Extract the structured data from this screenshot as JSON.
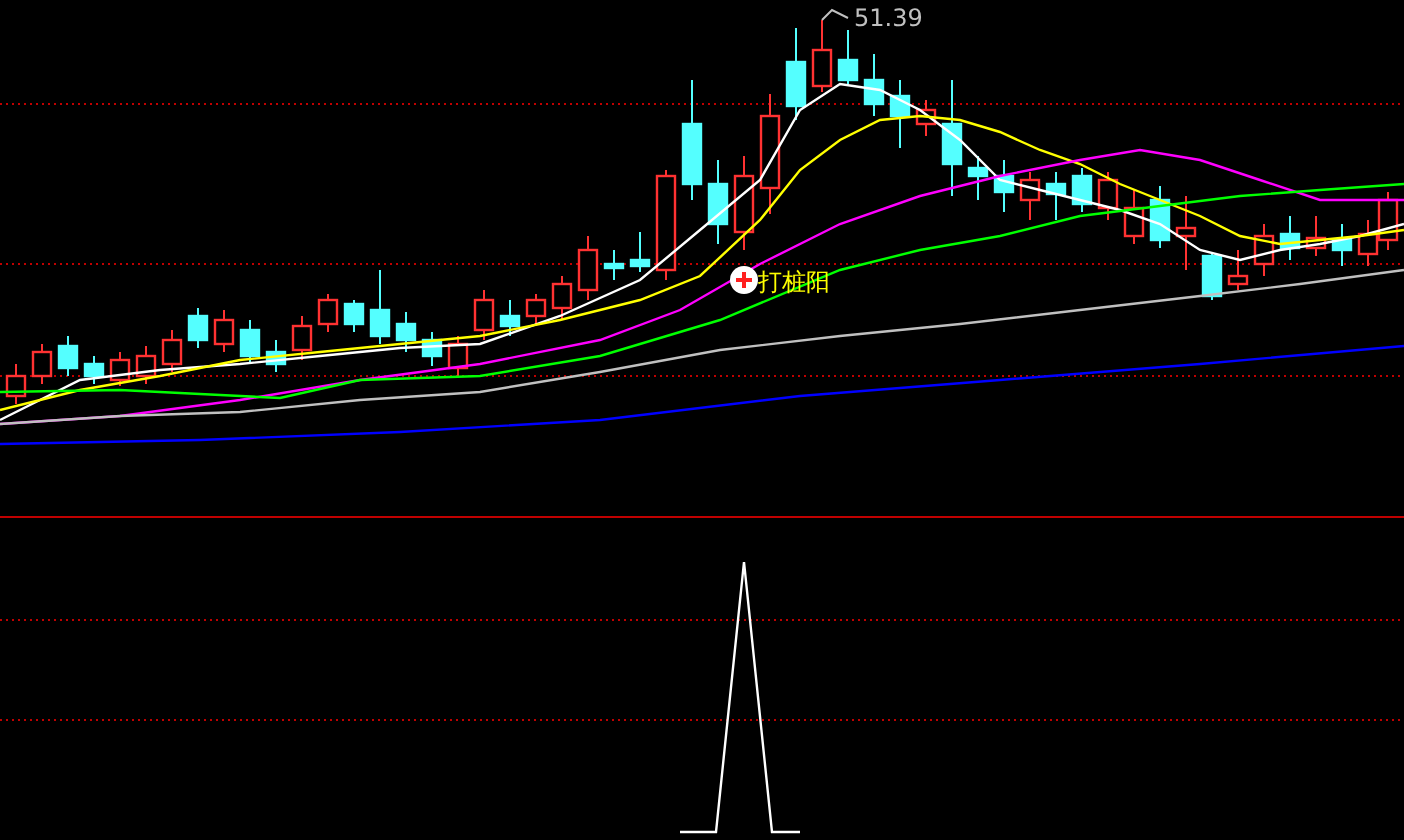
{
  "main_chart": {
    "high_label": "51.39",
    "signal_label": "打桩阳"
  }
}
